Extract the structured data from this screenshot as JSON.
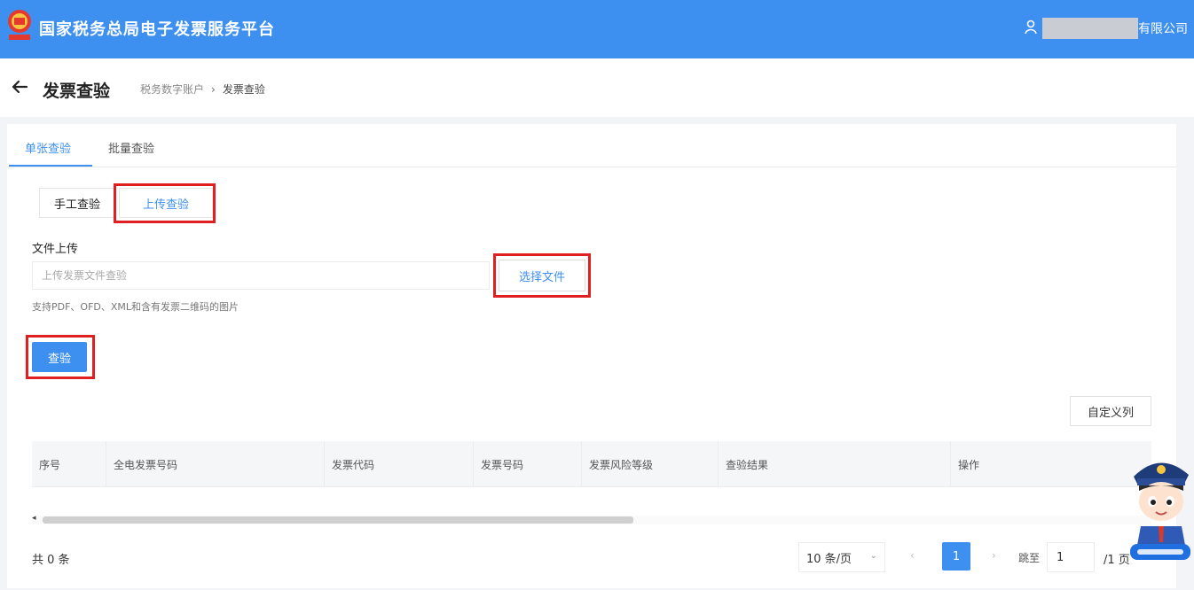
{
  "header": {
    "app_title": "国家税务总局电子发票服务平台",
    "user_suffix": "有限公司",
    "brand_color": "#3d8ff0"
  },
  "subheader": {
    "page_title": "发票查验",
    "breadcrumb": [
      "税务数字账户",
      "发票查验"
    ],
    "separator": "›"
  },
  "tabs": [
    {
      "label": "单张查验",
      "active": true
    },
    {
      "label": "批量查验",
      "active": false
    }
  ],
  "mode_toggle": {
    "manual_label": "手工查验",
    "upload_label": "上传查验",
    "selected": "上传查验"
  },
  "upload": {
    "label": "文件上传",
    "placeholder": "上传发票文件查验",
    "choose_file_label": "选择文件",
    "hint": "支持PDF、OFD、XML和含有发票二维码的图片"
  },
  "check_button_label": "查验",
  "table": {
    "custom_columns_label": "自定义列",
    "columns": [
      "序号",
      "全电发票号码",
      "发票代码",
      "发票号码",
      "发票风险等级",
      "查验结果",
      "操作"
    ]
  },
  "pagination": {
    "total_text": "共 0 条",
    "page_size": "10 条/页",
    "prev": "‹",
    "current_page": "1",
    "next": "›",
    "jump_label": "跳至",
    "jump_value": "1",
    "total_pages": "/1 页"
  },
  "icons": {
    "logo": "national-emblem-icon",
    "user": "user-icon",
    "back": "arrow-left-icon",
    "dropdown": "chevron-down-icon",
    "mascot": "tax-officer-mascot"
  }
}
